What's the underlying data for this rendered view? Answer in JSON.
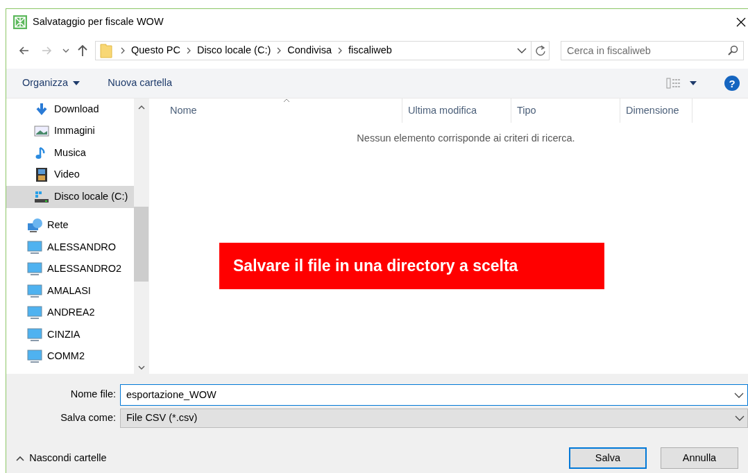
{
  "window": {
    "title": "Salvataggio per fiscale WOW"
  },
  "navigation": {
    "back_disabled": false,
    "forward_disabled": true,
    "path": [
      "Questo PC",
      "Disco locale (C:)",
      "Condivisa",
      "fiscaliweb"
    ],
    "search": {
      "placeholder": "Cerca in fiscaliweb"
    }
  },
  "toolbar": {
    "organize": "Organizza",
    "new_folder": "Nuova cartella",
    "help": "?"
  },
  "sidebar": {
    "items": [
      {
        "label": "Download",
        "kind": "download",
        "selected": false
      },
      {
        "label": "Immagini",
        "kind": "pictures",
        "selected": false
      },
      {
        "label": "Musica",
        "kind": "music",
        "selected": false
      },
      {
        "label": "Video",
        "kind": "video",
        "selected": false
      },
      {
        "label": "Disco locale (C:)",
        "kind": "drive",
        "selected": true
      },
      {
        "label": "Rete",
        "kind": "network",
        "selected": false,
        "children": [
          {
            "label": "ALESSANDRO",
            "kind": "computer",
            "selected": false
          },
          {
            "label": "ALESSANDRO2",
            "kind": "computer",
            "selected": false
          },
          {
            "label": "AMALASI",
            "kind": "computer",
            "selected": false
          },
          {
            "label": "ANDREA2",
            "kind": "computer",
            "selected": false
          },
          {
            "label": "CINZIA",
            "kind": "computer",
            "selected": false
          },
          {
            "label": "COMM2",
            "kind": "computer",
            "selected": false
          }
        ]
      }
    ]
  },
  "table": {
    "columns": [
      {
        "label": "Nome",
        "sorted": true
      },
      {
        "label": "Ultima modifica",
        "sorted": false
      },
      {
        "label": "Tipo",
        "sorted": false
      },
      {
        "label": "Dimensione",
        "sorted": false
      }
    ],
    "empty_message": "Nessun elemento corrisponde ai criteri di ricerca."
  },
  "annotation": "Salvare il file in una directory a scelta",
  "form": {
    "file_name_label": "Nome file:",
    "file_name": "esportazione_WOW",
    "type_label": "Salva come:",
    "type": "File CSV (*.csv)"
  },
  "footer": {
    "toggle": "Nascondi cartelle",
    "buttons": [
      {
        "label": "Salva",
        "default": true
      },
      {
        "label": "Annulla",
        "default": false
      }
    ]
  }
}
